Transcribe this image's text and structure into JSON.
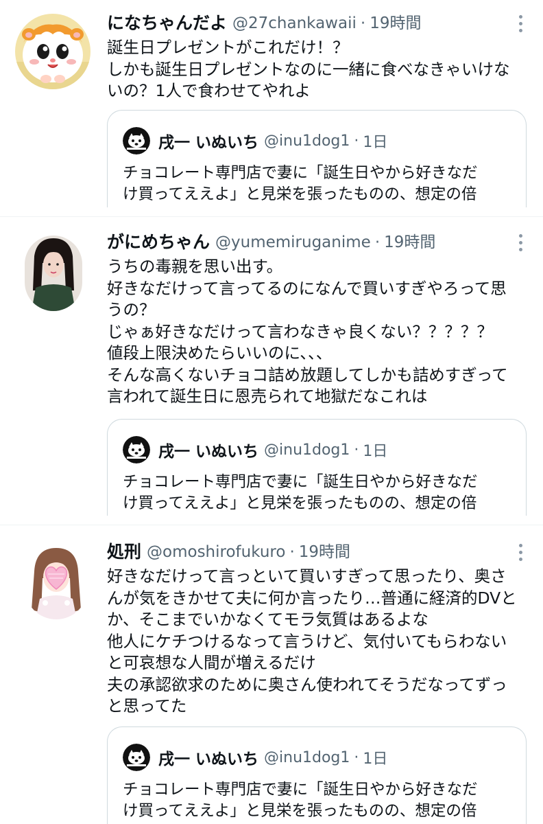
{
  "tweets": [
    {
      "name": "になちゃんだよ",
      "handle": "@27chankawaii",
      "separator": "·",
      "time": "19時間",
      "text_lines": [
        "誕生日プレゼントがこれだけ！？",
        "しかも誕生日プレゼントなのに一緒に食べなきゃいけな",
        "いの？1人で食わせてやれよ"
      ],
      "quote": {
        "name": "戌一 いぬいち",
        "handle": "@inu1dog1",
        "separator": "·",
        "time": "1日",
        "text_lines": [
          "チョコレート専門店で妻に「誕生日やから好きなだ",
          "け買ってええよ」と見栄を張ったものの、想定の倍"
        ]
      }
    },
    {
      "name": "がにめちゃん",
      "handle": "@yumemiruganime",
      "separator": "·",
      "time": "19時間",
      "text_lines": [
        "うちの毒親を思い出す。",
        "好きなだけって言ってるのになんで買いすぎやろって思",
        "うの？",
        "じゃぁ好きなだけって言わなきゃ良くない？？？？？",
        "値段上限決めたらいいのに、、、",
        "そんな高くないチョコ詰め放題してしかも詰めすぎって",
        "言われて誕生日に恩売られて地獄だなこれは"
      ],
      "quote": {
        "name": "戌一 いぬいち",
        "handle": "@inu1dog1",
        "separator": "·",
        "time": "1日",
        "text_lines": [
          "チョコレート専門店で妻に「誕生日やから好きなだ",
          "け買ってええよ」と見栄を張ったものの、想定の倍"
        ]
      }
    },
    {
      "name": "処刑",
      "handle": "@omoshirofukuro",
      "separator": "·",
      "time": "19時間",
      "text_lines": [
        "好きなだけって言っといて買いすぎって思ったり、奥さ",
        "んが気をきかせて夫に何か言ったり…普通に経済的DVと",
        "か、そこまでいかなくてモラ気質はあるよな",
        "他人にケチつけるなって言うけど、気付いてもらわない",
        "と可哀想な人間が増えるだけ",
        "夫の承認欲求のために奥さん使われてそうだなってずっ",
        "と思ってた"
      ],
      "quote": {
        "name": "戌一 いぬいち",
        "handle": "@inu1dog1",
        "separator": "·",
        "time": "1日",
        "text_lines": [
          "チョコレート専門店で妻に「誕生日やから好きなだ",
          "け買ってええよ」と見栄を張ったものの、想定の倍"
        ]
      }
    }
  ],
  "colors": {
    "text_primary": "#0f1419",
    "text_secondary": "#536471",
    "border": "#cfd9de",
    "divider": "#eff3f4"
  },
  "icons": {
    "more": "more-vertical-icon",
    "avatar_1": "hamster-avatar",
    "avatar_2": "person-avatar",
    "avatar_3": "illustrated-girl-avatar",
    "quote_avatar": "dog-logo-avatar"
  }
}
